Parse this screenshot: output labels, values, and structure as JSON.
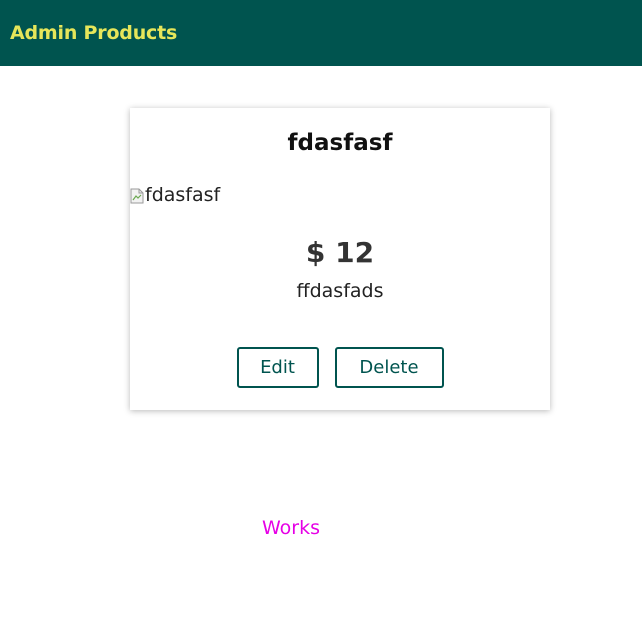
{
  "header": {
    "title": "Admin Products"
  },
  "product": {
    "title": "fdasfasf",
    "image_alt": "fdasfasf",
    "price": "$ 12",
    "description": "ffdasfads",
    "edit_label": "Edit",
    "delete_label": "Delete"
  },
  "status_text": "Works",
  "colors": {
    "header_bg": "#00544f",
    "header_text": "#e6e65a",
    "button_border": "#00544f",
    "status_text": "#e600e6"
  },
  "icons": {
    "image": "broken-image-icon"
  }
}
